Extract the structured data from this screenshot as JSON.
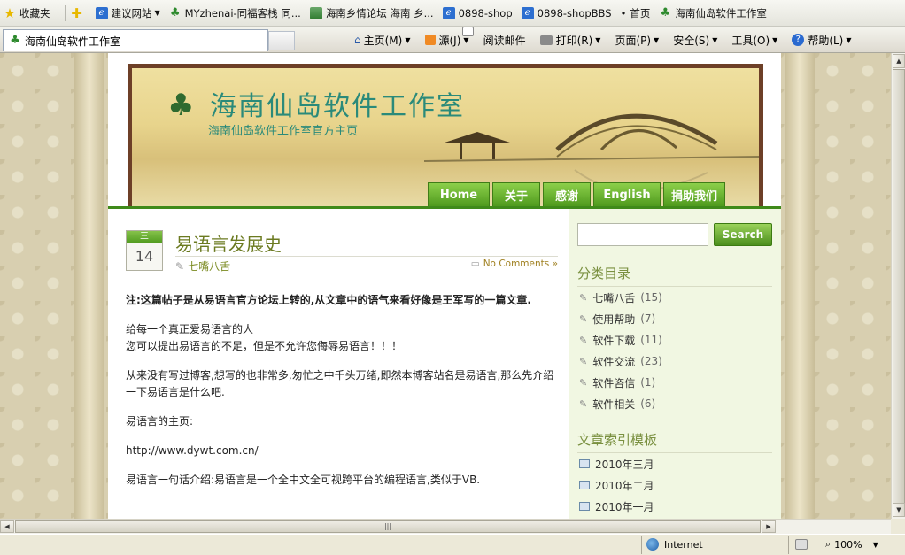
{
  "favorites_bar": {
    "favorites_label": "收藏夹",
    "items": [
      {
        "label": "建议网站",
        "icon": "ie-icon",
        "dropdown": true
      },
      {
        "label": "MYzhenai-同福客栈 同...",
        "icon": "site-icon"
      },
      {
        "label": "海南乡情论坛 海南 乡...",
        "icon": "site-icon"
      },
      {
        "label": "0898-shop",
        "icon": "ie-icon"
      },
      {
        "label": "0898-shopBBS",
        "icon": "ie-icon"
      },
      {
        "label": "首页",
        "icon": "dot"
      },
      {
        "label": "海南仙岛软件工作室",
        "icon": "plant-icon"
      }
    ]
  },
  "command_bar": {
    "tab_title": "海南仙岛软件工作室",
    "commands": [
      {
        "label": "主页(M)",
        "icon": "home-icon"
      },
      {
        "label": "源(J)",
        "icon": "rss-icon"
      },
      {
        "label": "阅读邮件",
        "icon": "mail-icon"
      },
      {
        "label": "打印(R)",
        "icon": "print-icon"
      },
      {
        "label": "页面(P)",
        "icon": "page-icon"
      },
      {
        "label": "安全(S)",
        "icon": "shield-icon"
      },
      {
        "label": "工具(O)",
        "icon": "gear-icon"
      },
      {
        "label": "帮助(L)",
        "icon": "help-icon"
      }
    ]
  },
  "site": {
    "title": "海南仙岛软件工作室",
    "subtitle": "海南仙岛软件工作室官方主页",
    "nav": [
      "Home",
      "关于",
      "感谢",
      "English",
      "捐助我们"
    ]
  },
  "post": {
    "month": "三",
    "day": "14",
    "title": "易语言发展史",
    "category": "七嘴八舌",
    "comments": "No Comments »",
    "paragraphs": [
      {
        "text": "注:这篇帖子是从易语言官方论坛上转的,从文章中的语气来看好像是王军写的一篇文章.",
        "bold": true
      },
      {
        "lines": [
          "给每一个真正爱易语言的人",
          "您可以提出易语言的不足，但是不允许您侮辱易语言！！！"
        ]
      },
      {
        "text": "从来没有写过博客,想写的也非常多,匆忙之中千头万绪,即然本博客站名是易语言,那么先介绍一下易语言是什么吧."
      },
      {
        "text": "易语言的主页:"
      },
      {
        "text": "http://www.dywt.com.cn/"
      },
      {
        "text": "易语言一句话介绍:易语言是一个全中文全可视跨平台的编程语言,类似于VB."
      }
    ]
  },
  "sidebar": {
    "search_button": "Search",
    "search_value": "",
    "categories_title": "分类目录",
    "categories": [
      {
        "name": "七嘴八舌",
        "count": "(15)"
      },
      {
        "name": "使用帮助",
        "count": "(7)"
      },
      {
        "name": "软件下载",
        "count": "(11)"
      },
      {
        "name": "软件交流",
        "count": "(23)"
      },
      {
        "name": "软件咨信",
        "count": "(1)"
      },
      {
        "name": "软件相关",
        "count": "(6)"
      }
    ],
    "archives_title": "文章索引模板",
    "archives": [
      "2010年三月",
      "2010年二月",
      "2010年一月"
    ]
  },
  "status_bar": {
    "zone": "Internet",
    "zoom": "100%"
  }
}
